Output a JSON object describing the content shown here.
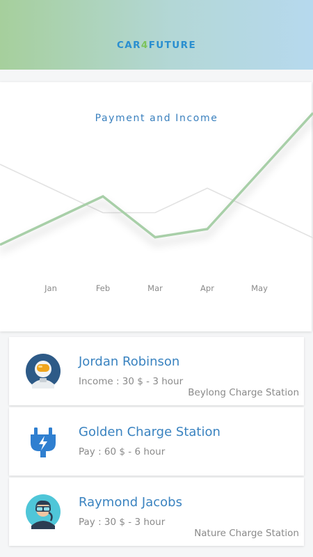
{
  "header": {
    "logo_part1": "CAR",
    "logo_part2": "4",
    "logo_part3": "FUTURE"
  },
  "chart_data": {
    "type": "line",
    "title": "Payment and Income",
    "categories": [
      "Jan",
      "Feb",
      "Mar",
      "Apr",
      "May"
    ],
    "series": [
      {
        "values": [
          2.5,
          4.0,
          1.5,
          2.0,
          5.5
        ],
        "color": "#a8cfa8"
      },
      {
        "values": [
          4.5,
          3.0,
          3.0,
          4.5,
          3.0
        ],
        "color": "#e2e2e2"
      }
    ],
    "ylim": [
      0,
      8
    ],
    "grid": false
  },
  "cards": [
    {
      "name": "Jordan Robinson",
      "detail": "Income : 30 $ - 3 hour",
      "station": "Beylong Charge Station",
      "icon": "astronaut-avatar-icon"
    },
    {
      "name": "Golden Charge Station",
      "detail": "Pay : 60 $ - 6 hour",
      "station": "",
      "icon": "charging-plug-icon"
    },
    {
      "name": "Raymond Jacobs",
      "detail": "Pay : 30 $ - 3 hour",
      "station": "Nature Charge Station",
      "icon": "diver-avatar-icon"
    }
  ]
}
